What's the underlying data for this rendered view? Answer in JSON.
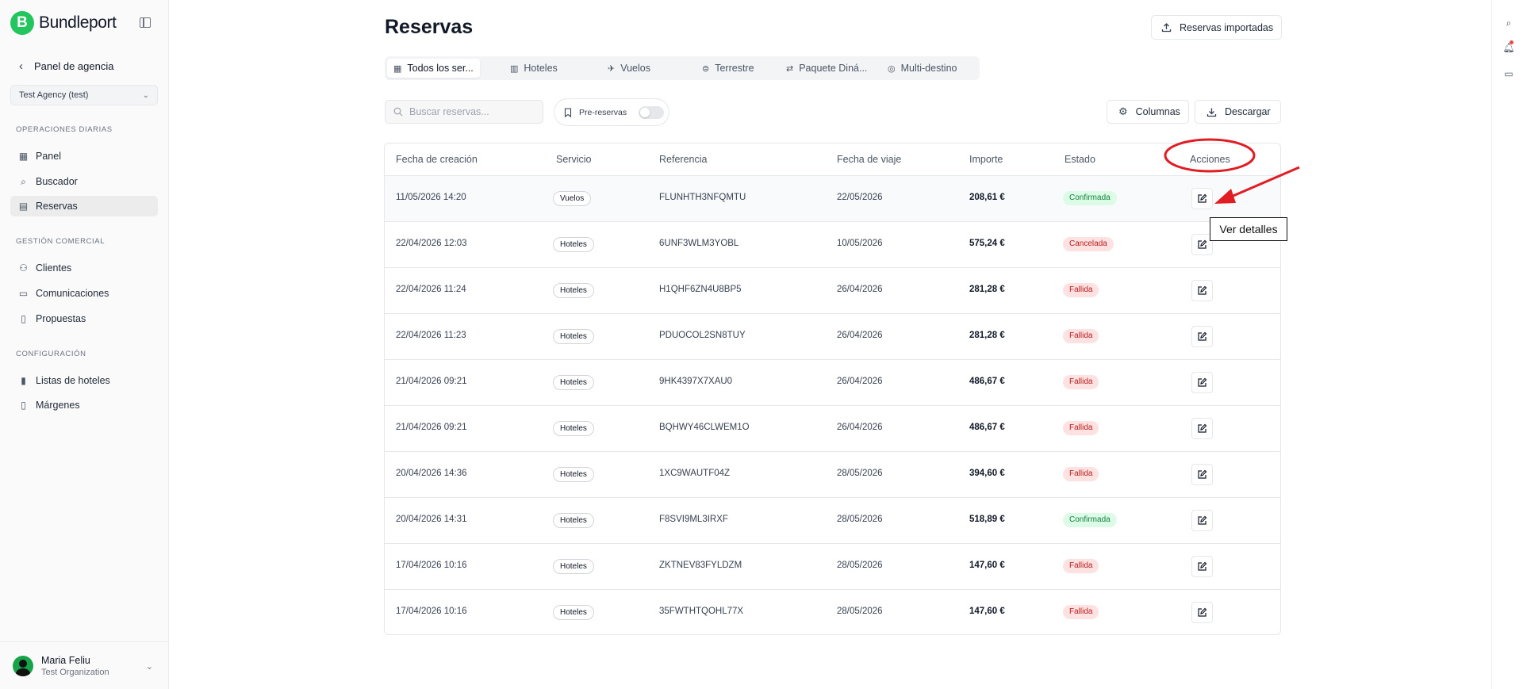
{
  "brand": {
    "logo_letter": "B",
    "name": "Bundleport"
  },
  "sidebar": {
    "back_label": "Panel de agencia",
    "agency": "Test Agency (test)",
    "sections": {
      "daily": "OPERACIONES DIARIAS",
      "commercial": "GESTIÓN COMERCIAL",
      "config": "CONFIGURACIÓN"
    },
    "items": [
      {
        "label": "Panel",
        "icon": "grid-icon"
      },
      {
        "label": "Buscador",
        "icon": "search-icon"
      },
      {
        "label": "Reservas",
        "icon": "calendar-icon",
        "active": true
      },
      {
        "label": "Clientes",
        "icon": "users-icon"
      },
      {
        "label": "Comunicaciones",
        "icon": "message-icon"
      },
      {
        "label": "Propuestas",
        "icon": "document-icon"
      },
      {
        "label": "Listas de hoteles",
        "icon": "bookmark-icon"
      },
      {
        "label": "Márgenes",
        "icon": "document-icon"
      }
    ],
    "user": {
      "name": "Maria Feliu",
      "org": "Test Organization"
    }
  },
  "page": {
    "title": "Reservas",
    "import_button": "Reservas importadas",
    "tabs": [
      {
        "label": "Todos los ser...",
        "icon": "grid-icon",
        "active": true
      },
      {
        "label": "Hoteles",
        "icon": "building-icon"
      },
      {
        "label": "Vuelos",
        "icon": "plane-icon"
      },
      {
        "label": "Terrestre",
        "icon": "car-icon"
      },
      {
        "label": "Paquete Diná...",
        "icon": "route-icon"
      },
      {
        "label": "Multi-destino",
        "icon": "globe-icon"
      }
    ],
    "search_placeholder": "Buscar reservas...",
    "prereserve_label": "Pre-reservas",
    "prereserve_enabled": false,
    "columns_button": "Columnas",
    "download_button": "Descargar"
  },
  "table": {
    "headers": [
      "Fecha de creación",
      "Servicio",
      "Referencia",
      "Fecha de viaje",
      "Importe",
      "Estado",
      "Acciones"
    ],
    "rows": [
      {
        "created": "11/05/2026 14:20",
        "service": "Vuelos",
        "reference": "FLUNHTH3NFQMTU",
        "travel": "22/05/2026",
        "amount": "208,61 €",
        "status": "Confirmada",
        "status_type": "ok"
      },
      {
        "created": "22/04/2026 12:03",
        "service": "Hoteles",
        "reference": "6UNF3WLM3YOBL",
        "travel": "10/05/2026",
        "amount": "575,24 €",
        "status": "Cancelada",
        "status_type": "cancel"
      },
      {
        "created": "22/04/2026 11:24",
        "service": "Hoteles",
        "reference": "H1QHF6ZN4U8BP5",
        "travel": "26/04/2026",
        "amount": "281,28 €",
        "status": "Fallida",
        "status_type": "fail"
      },
      {
        "created": "22/04/2026 11:23",
        "service": "Hoteles",
        "reference": "PDUOCOL2SN8TUY",
        "travel": "26/04/2026",
        "amount": "281,28 €",
        "status": "Fallida",
        "status_type": "fail"
      },
      {
        "created": "21/04/2026 09:21",
        "service": "Hoteles",
        "reference": "9HK4397X7XAU0",
        "travel": "26/04/2026",
        "amount": "486,67 €",
        "status": "Fallida",
        "status_type": "fail"
      },
      {
        "created": "21/04/2026 09:21",
        "service": "Hoteles",
        "reference": "BQHWY46CLWEM1O",
        "travel": "26/04/2026",
        "amount": "486,67 €",
        "status": "Fallida",
        "status_type": "fail"
      },
      {
        "created": "20/04/2026 14:36",
        "service": "Hoteles",
        "reference": "1XC9WAUTF04Z",
        "travel": "28/05/2026",
        "amount": "394,60 €",
        "status": "Fallida",
        "status_type": "fail"
      },
      {
        "created": "20/04/2026 14:31",
        "service": "Hoteles",
        "reference": "F8SVI9ML3IRXF",
        "travel": "28/05/2026",
        "amount": "518,89 €",
        "status": "Confirmada",
        "status_type": "ok"
      },
      {
        "created": "17/04/2026 10:16",
        "service": "Hoteles",
        "reference": "ZKTNEV83FYLDZM",
        "travel": "28/05/2026",
        "amount": "147,60 €",
        "status": "Fallida",
        "status_type": "fail"
      },
      {
        "created": "17/04/2026 10:16",
        "service": "Hoteles",
        "reference": "35FWTHTQOHL77X",
        "travel": "28/05/2026",
        "amount": "147,60 €",
        "status": "Fallida",
        "status_type": "fail"
      }
    ]
  },
  "annotation": {
    "tooltip": "Ver detalles",
    "color": "#e11d24"
  },
  "colors": {
    "brand": "#22c55e",
    "confirmed": "#15803d",
    "failed": "#b91c1c"
  }
}
